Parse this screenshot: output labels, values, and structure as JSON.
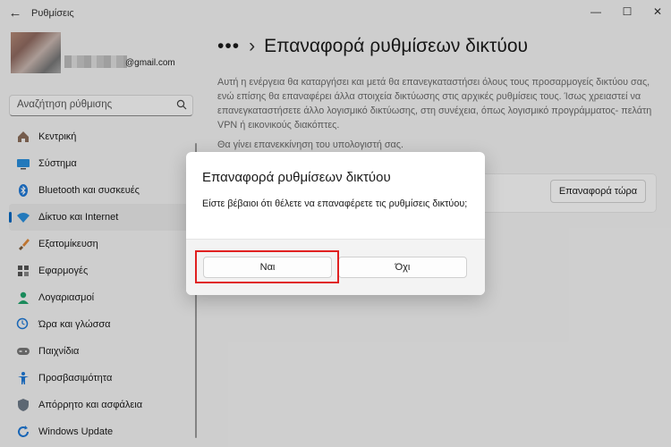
{
  "window": {
    "title": "Ρυθμίσεις",
    "minimize": "—",
    "maximize": "☐",
    "close": "✕",
    "back": "←"
  },
  "profile": {
    "email_suffix": "@gmail.com"
  },
  "search": {
    "placeholder": "Αναζήτηση ρύθμισης"
  },
  "sidebar": {
    "items": [
      {
        "label": "Κεντρική",
        "icon": "home-icon"
      },
      {
        "label": "Σύστημα",
        "icon": "system-icon"
      },
      {
        "label": "Bluetooth και συσκευές",
        "icon": "bluetooth-icon"
      },
      {
        "label": "Δίκτυο και Internet",
        "icon": "network-icon",
        "selected": true
      },
      {
        "label": "Εξατομίκευση",
        "icon": "brush-icon"
      },
      {
        "label": "Εφαρμογές",
        "icon": "apps-icon"
      },
      {
        "label": "Λογαριασμοί",
        "icon": "account-icon"
      },
      {
        "label": "Ώρα και γλώσσα",
        "icon": "time-language-icon"
      },
      {
        "label": "Παιχνίδια",
        "icon": "gamepad-icon"
      },
      {
        "label": "Προσβασιμότητα",
        "icon": "accessibility-icon"
      },
      {
        "label": "Απόρρητο και ασφάλεια",
        "icon": "shield-icon"
      },
      {
        "label": "Windows Update",
        "icon": "update-icon"
      }
    ]
  },
  "main": {
    "breadcrumb_more": "•••",
    "breadcrumb_sep": "›",
    "title": "Επαναφορά ρυθμίσεων δικτύου",
    "description": "Αυτή η ενέργεια θα καταργήσει και μετά θα επανεγκαταστήσει όλους τους προσαρμογείς δικτύου σας, ενώ επίσης θα επαναφέρει άλλα στοιχεία δικτύωσης στις αρχικές ρυθμίσεις τους. Ίσως χρειαστεί να επανεγκαταστήσετε άλλο λογισμικό δικτύωσης, στη συνέχεια, όπως λογισμικό προγράμματος- πελάτη VPN ή εικονικούς διακόπτες.",
    "restart_note": "Θα γίνει επανεκκίνηση του υπολογιστή σας.",
    "reset_button": "Επαναφορά τώρα"
  },
  "dialog": {
    "title": "Επαναφορά ρυθμίσεων δικτύου",
    "message": "Είστε βέβαιοι ότι θέλετε να επαναφέρετε τις ρυθμίσεις δικτύου;",
    "yes": "Ναι",
    "no": "Όχι"
  },
  "colors": {
    "accent": "#0067c0",
    "highlight": "#e02020"
  }
}
